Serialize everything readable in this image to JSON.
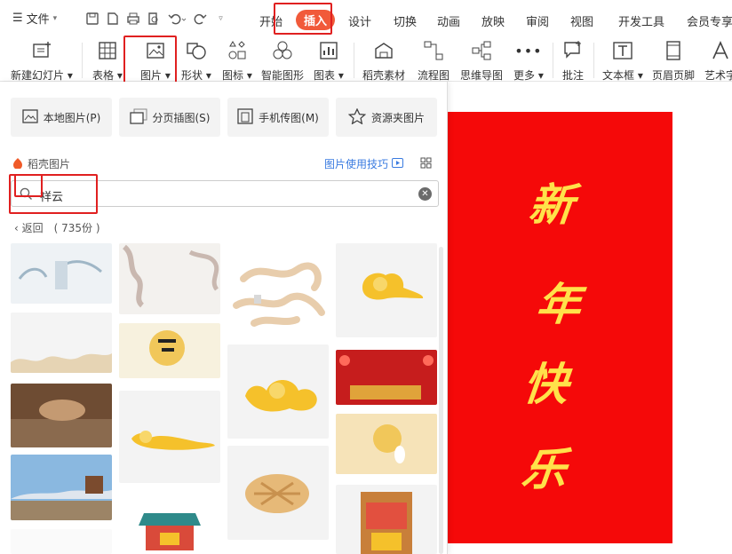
{
  "topbar": {
    "file_menu": "文件",
    "tabs": [
      "开始",
      "插入",
      "设计",
      "切换",
      "动画",
      "放映",
      "审阅",
      "视图",
      "开发工具",
      "会员专享"
    ],
    "active_tab": "插入"
  },
  "ribbon": {
    "new_slide": "新建幻灯片",
    "table": "表格",
    "picture": "图片",
    "shape": "形状",
    "icon": "图标",
    "smart_graphic": "智能图形",
    "chart": "图表",
    "daoke_material": "稻壳素材",
    "flowchart": "流程图",
    "mindmap": "思维导图",
    "more": "更多",
    "comment": "批注",
    "textbox": "文本框",
    "header_footer": "页眉页脚",
    "art_text": "艺术字"
  },
  "panel": {
    "local_picture": "本地图片(P)",
    "paged_picture": "分页插图(S)",
    "phone_picture": "手机传图(M)",
    "folder_picture": "资源夹图片",
    "brand": "稻壳图片",
    "tips": "图片使用技巧",
    "search_value": "祥云",
    "back": "返回",
    "count": "( 735份 )"
  },
  "slide": {
    "chars": [
      "新",
      "年",
      "快",
      "乐"
    ],
    "bg_color": "#f50909",
    "text_color": "#ffe24a"
  },
  "colors": {
    "accent": "#f15a3a",
    "annotation": "#e02020",
    "link": "#3a7be0"
  }
}
